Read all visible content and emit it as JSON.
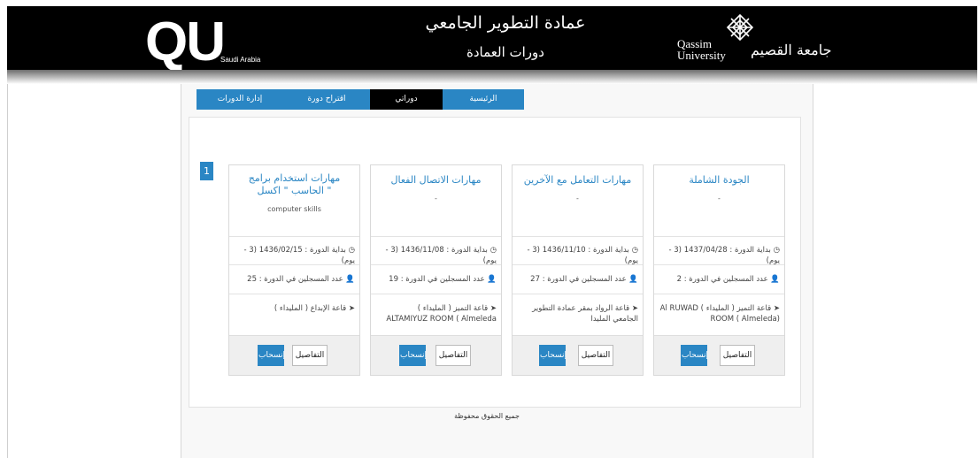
{
  "header": {
    "logo_text": "QU",
    "logo_sub": "Saudi Arabia",
    "title": "عمادة التطوير الجامعي",
    "subtitle": "دورات العمادة",
    "university_en": "Qassim University",
    "university_ar": "جامعة القصيم"
  },
  "nav": {
    "items": [
      {
        "label": "الرئيسية",
        "active": false
      },
      {
        "label": "دوراتي",
        "active": true
      },
      {
        "label": "اقتراح دورة",
        "active": false
      },
      {
        "label": "إدارة الدورات",
        "active": false
      }
    ]
  },
  "pagination": {
    "current": "1"
  },
  "cards": [
    {
      "title": "الجودة الشاملة",
      "subtitle": "-",
      "start": "بداية الدورة : 1437/04/28 (3 - يوم)",
      "registered": "عدد المسجلين في الدورة : 2",
      "location": "قاعة التميز ( المليداء ) Al RUWAD ROOM ( Almeleda)",
      "details_label": "التفاصيل",
      "withdraw_label": "إنسحاب"
    },
    {
      "title": "مهارات التعامل مع الآخرين",
      "subtitle": "-",
      "start": "بداية الدورة : 1436/11/10 (3 - يوم)",
      "registered": "عدد المسجلين في الدورة : 27",
      "location": "قاعة الرواد بمقر عمادة التطوير الجامعي المليدا",
      "details_label": "التفاصيل",
      "withdraw_label": "إنسحاب"
    },
    {
      "title": "مهارات الاتصال الفعال",
      "subtitle": "-",
      "start": "بداية الدورة : 1436/11/08 (3 - يوم)",
      "registered": "عدد المسجلين في الدورة : 19",
      "location": "قاعة التميز ( المليداء ) ALTAMIYUZ ROOM ( Almeleda",
      "details_label": "التفاصيل",
      "withdraw_label": "إنسحاب"
    },
    {
      "title": "مهارات استخدام برامج الحاسب \" اكسل \"",
      "subtitle": "computer skills",
      "start": "بداية الدورة : 1436/02/15 (3 - يوم)",
      "registered": "عدد المسجلين في الدورة : 25",
      "location": "قاعة الإبداع ( المليداء )",
      "details_label": "التفاصيل",
      "withdraw_label": "إنسحاب"
    }
  ],
  "footer": {
    "text": "جميع الحقوق محفوظة"
  },
  "icons": {
    "clock": "clock-icon",
    "user": "user-icon",
    "location": "location-arrow-icon"
  },
  "colors": {
    "accent": "#2a86c4",
    "header_bg": "#000000"
  }
}
